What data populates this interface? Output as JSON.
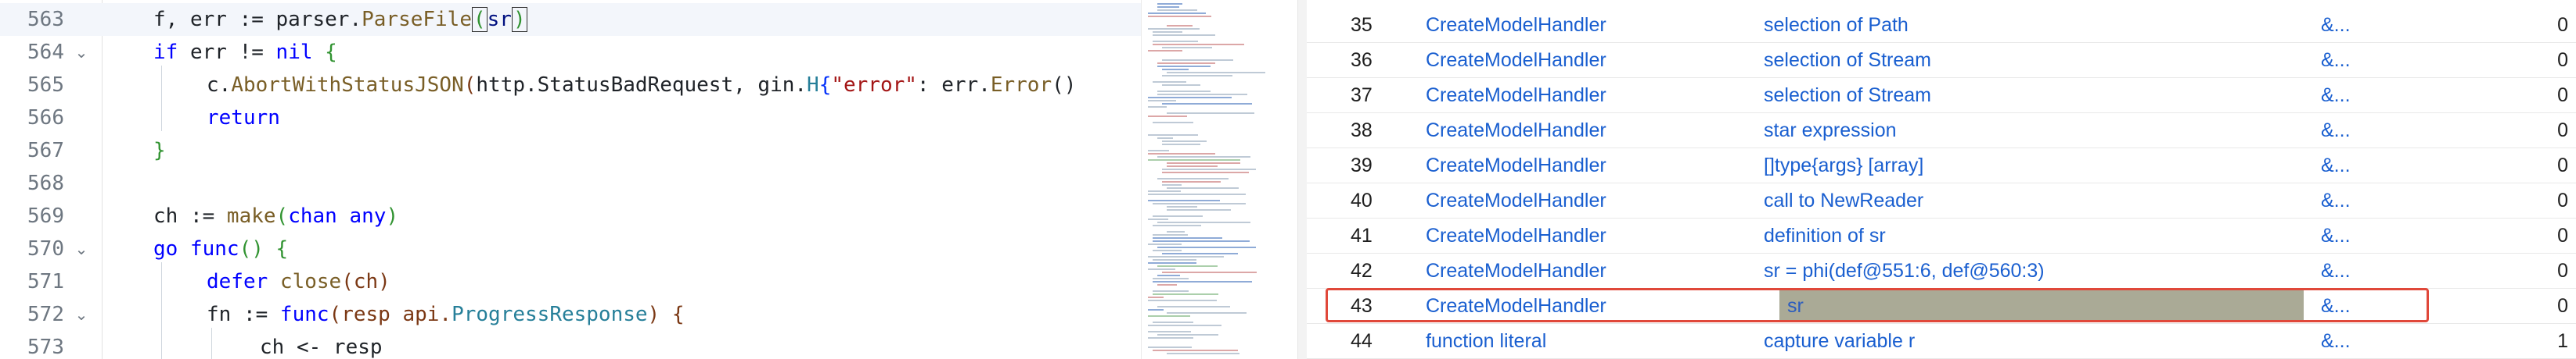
{
  "editor": {
    "lines": [
      {
        "num": "563",
        "fold": ""
      },
      {
        "num": "564",
        "fold": "⌄"
      },
      {
        "num": "565",
        "fold": ""
      },
      {
        "num": "566",
        "fold": ""
      },
      {
        "num": "567",
        "fold": ""
      },
      {
        "num": "568",
        "fold": ""
      },
      {
        "num": "569",
        "fold": ""
      },
      {
        "num": "570",
        "fold": "⌄"
      },
      {
        "num": "571",
        "fold": ""
      },
      {
        "num": "572",
        "fold": "⌄"
      },
      {
        "num": "573",
        "fold": ""
      }
    ],
    "tokens": {
      "l563": [
        "f, err := parser.",
        "ParseFile",
        "(",
        "sr",
        ")"
      ],
      "l564": [
        "if",
        " err != ",
        "nil",
        " {"
      ],
      "l565": [
        "c.",
        "AbortWithStatusJSON",
        "(",
        "http.StatusBadRequest, gin.",
        "H",
        "{",
        "\"error\"",
        ": err.",
        "Error",
        "()"
      ],
      "l566": [
        "return"
      ],
      "l567": [
        "}"
      ],
      "l569": [
        "ch := ",
        "make",
        "(",
        "chan",
        " ",
        "any",
        ")"
      ],
      "l570": [
        "go",
        " ",
        "func",
        "() {"
      ],
      "l571": [
        "defer",
        " ",
        "close",
        "(ch)"
      ],
      "l572": [
        "fn := ",
        "func",
        "(resp api.",
        "ProgressResponse",
        ") {"
      ],
      "l573": [
        "ch <- resp"
      ]
    }
  },
  "results": {
    "rows": [
      {
        "idx": "35",
        "fn": "CreateModelHandler",
        "desc": "selection of Path",
        "link": "&...",
        "count": "0"
      },
      {
        "idx": "36",
        "fn": "CreateModelHandler",
        "desc": "selection of Stream",
        "link": "&...",
        "count": "0"
      },
      {
        "idx": "37",
        "fn": "CreateModelHandler",
        "desc": "selection of Stream",
        "link": "&...",
        "count": "0"
      },
      {
        "idx": "38",
        "fn": "CreateModelHandler",
        "desc": "star expression",
        "link": "&...",
        "count": "0"
      },
      {
        "idx": "39",
        "fn": "CreateModelHandler",
        "desc": "[]type{args} [array]",
        "link": "&...",
        "count": "0"
      },
      {
        "idx": "40",
        "fn": "CreateModelHandler",
        "desc": "call to NewReader",
        "link": "&...",
        "count": "0"
      },
      {
        "idx": "41",
        "fn": "CreateModelHandler",
        "desc": "definition of sr",
        "link": "&...",
        "count": "0"
      },
      {
        "idx": "42",
        "fn": "CreateModelHandler",
        "desc": "sr = phi(def@551:6, def@560:3)",
        "link": "&...",
        "count": "0"
      },
      {
        "idx": "43",
        "fn": "CreateModelHandler",
        "desc": "sr",
        "link": "&...",
        "count": "0"
      },
      {
        "idx": "44",
        "fn": "function literal",
        "desc": "capture variable r",
        "link": "&...",
        "count": "1"
      }
    ],
    "selected_index": 8
  },
  "colors": {
    "accent_link": "#1a5fd0",
    "selection_outline": "#e0483a",
    "selection_fill": "#aaaa96"
  }
}
